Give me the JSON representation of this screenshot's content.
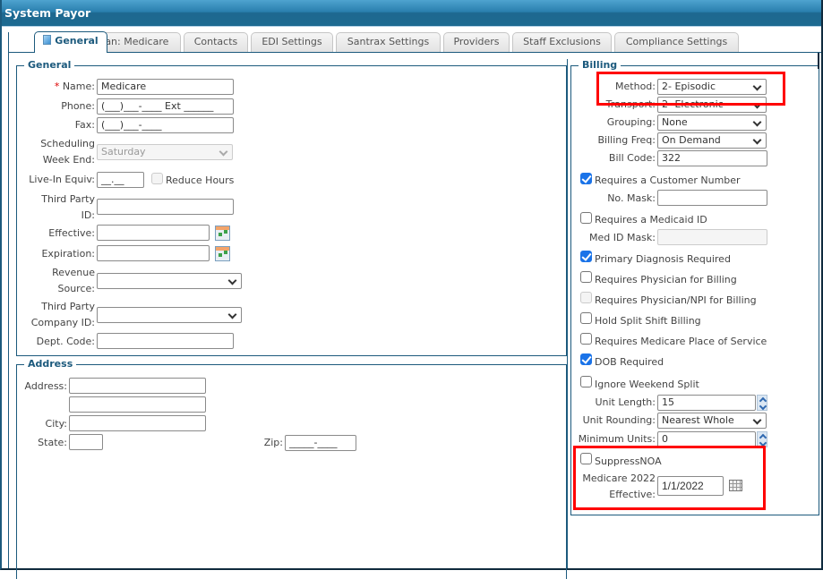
{
  "window": {
    "title": "System Payor"
  },
  "tabs": [
    {
      "label": "General",
      "active": true
    },
    {
      "label": "Plan: Medicare",
      "active": false
    },
    {
      "label": "Contacts",
      "active": false
    },
    {
      "label": "EDI Settings",
      "active": false
    },
    {
      "label": "Santrax Settings",
      "active": false
    },
    {
      "label": "Providers",
      "active": false
    },
    {
      "label": "Staff Exclusions",
      "active": false
    },
    {
      "label": "Compliance Settings",
      "active": false
    }
  ],
  "general": {
    "legend": "General",
    "required_marker": "*",
    "name_label": "Name:",
    "name_value": "Medicare",
    "phone_label": "Phone:",
    "phone_value": "(___)___-____ Ext ______",
    "fax_label": "Fax:",
    "fax_value": "(___)___-____",
    "sched_label_1": "Scheduling",
    "sched_label_2": "Week End:",
    "sched_value": "Saturday",
    "livein_label": "Live-In Equiv:",
    "livein_value": "__.__",
    "reduce_hours_label": "Reduce Hours",
    "reduce_hours_checked": false,
    "tpid_label_1": "Third Party",
    "tpid_label_2": "ID:",
    "tpid_value": "",
    "effective_label": "Effective:",
    "effective_value": "",
    "expiration_label": "Expiration:",
    "expiration_value": "",
    "revenue_label_1": "Revenue",
    "revenue_label_2": "Source:",
    "revenue_value": "",
    "tpcompany_label_1": "Third Party",
    "tpcompany_label_2": "Company ID:",
    "tpcompany_value": "",
    "dept_label": "Dept. Code:",
    "dept_value": ""
  },
  "address": {
    "legend": "Address",
    "address_label": "Address:",
    "address1_value": "",
    "address2_value": "",
    "city_label": "City:",
    "city_value": "",
    "state_label": "State:",
    "state_value": "",
    "zip_label": "Zip:",
    "zip_value": "_____-____"
  },
  "billing": {
    "legend": "Billing",
    "method_label": "Method:",
    "method_value": "2- Episodic",
    "transport_label": "Transport:",
    "transport_value": "2- Electronic",
    "grouping_label": "Grouping:",
    "grouping_value": "None",
    "freq_label": "Billing Freq:",
    "freq_value": "On Demand",
    "billcode_label": "Bill Code:",
    "billcode_value": "322",
    "req_customer_label": "Requires a Customer Number",
    "req_customer_checked": true,
    "nomask_label": "No. Mask:",
    "nomask_value": "",
    "req_medicaid_label": "Requires a Medicaid ID",
    "req_medicaid_checked": false,
    "medidmask_label": "Med ID Mask:",
    "medidmask_value": "",
    "primary_dx_label": "Primary Diagnosis Required",
    "primary_dx_checked": true,
    "req_physician_label": "Requires Physician for Billing",
    "req_physician_checked": false,
    "req_physician_npi_label": "Requires Physician/NPI for Billing",
    "req_physician_npi_checked": false,
    "hold_split_label": "Hold Split Shift Billing",
    "hold_split_checked": false,
    "req_medicare_pos_label": "Requires Medicare Place of Service",
    "req_medicare_pos_checked": false,
    "dob_label": "DOB Required",
    "dob_checked": true,
    "ignore_weekend_label": "Ignore Weekend Split",
    "ignore_weekend_checked": false,
    "unit_length_label": "Unit Length:",
    "unit_length_value": "15",
    "unit_rounding_label": "Unit Rounding:",
    "unit_rounding_value": "Nearest Whole",
    "min_units_label": "Minimum Units:",
    "min_units_value": "0",
    "suppress_noa_label": "SuppressNOA",
    "suppress_noa_checked": false,
    "medicare2022_label_1": "Medicare 2022",
    "medicare2022_label_2": "Effective:",
    "medicare2022_value": "1/1/2022"
  },
  "colors": {
    "accent": "#1c5a7d",
    "title_bar": "#1e6890",
    "highlight": "#ff0000",
    "checkbox_checked": "#1a73e8",
    "required": "#dd0000"
  }
}
